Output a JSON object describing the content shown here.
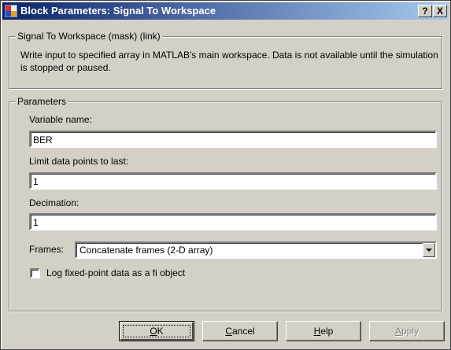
{
  "window": {
    "title": "Block Parameters: Signal To Workspace",
    "help_button": "?",
    "close_button": "X",
    "app_icon": "simulink-block-icon"
  },
  "description_group": {
    "legend": "Signal To Workspace (mask) (link)",
    "text": "Write input to specified array in MATLAB's main workspace.  Data is not available until the simulation is stopped or paused."
  },
  "parameters_group": {
    "legend": "Parameters",
    "variable_name": {
      "label": "Variable name:",
      "value": "BER"
    },
    "limit_data_points": {
      "label": "Limit data points to last:",
      "value": "1"
    },
    "decimation": {
      "label": "Decimation:",
      "value": "1"
    },
    "frames": {
      "label": "Frames:",
      "value": "Concatenate frames (2-D array)"
    },
    "log_fixed_point": {
      "label": "Log fixed-point data as a fi object",
      "checked": false
    }
  },
  "buttons": {
    "ok": {
      "mnemonic": "O",
      "rest": "K"
    },
    "cancel": {
      "mnemonic": "C",
      "rest": "ancel"
    },
    "help": {
      "mnemonic": "H",
      "rest": "elp"
    },
    "apply": {
      "mnemonic": "A",
      "rest": "pply",
      "disabled": true
    }
  }
}
